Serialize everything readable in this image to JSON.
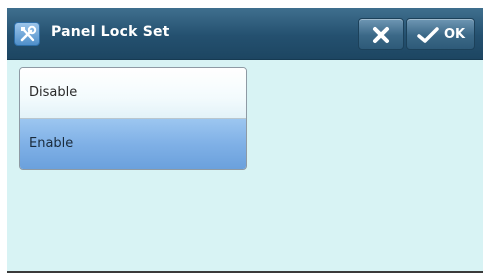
{
  "header": {
    "title": "Panel Lock Set",
    "icon": "tools-icon",
    "cancel_icon": "close-x-icon",
    "ok_icon": "checkmark-icon",
    "ok_label": "OK"
  },
  "options": [
    {
      "label": "Disable",
      "selected": false
    },
    {
      "label": "Enable",
      "selected": true
    }
  ],
  "colors": {
    "titlebar": "#24506f",
    "background": "#d8f3f4",
    "selected": "#7fb0e6"
  }
}
